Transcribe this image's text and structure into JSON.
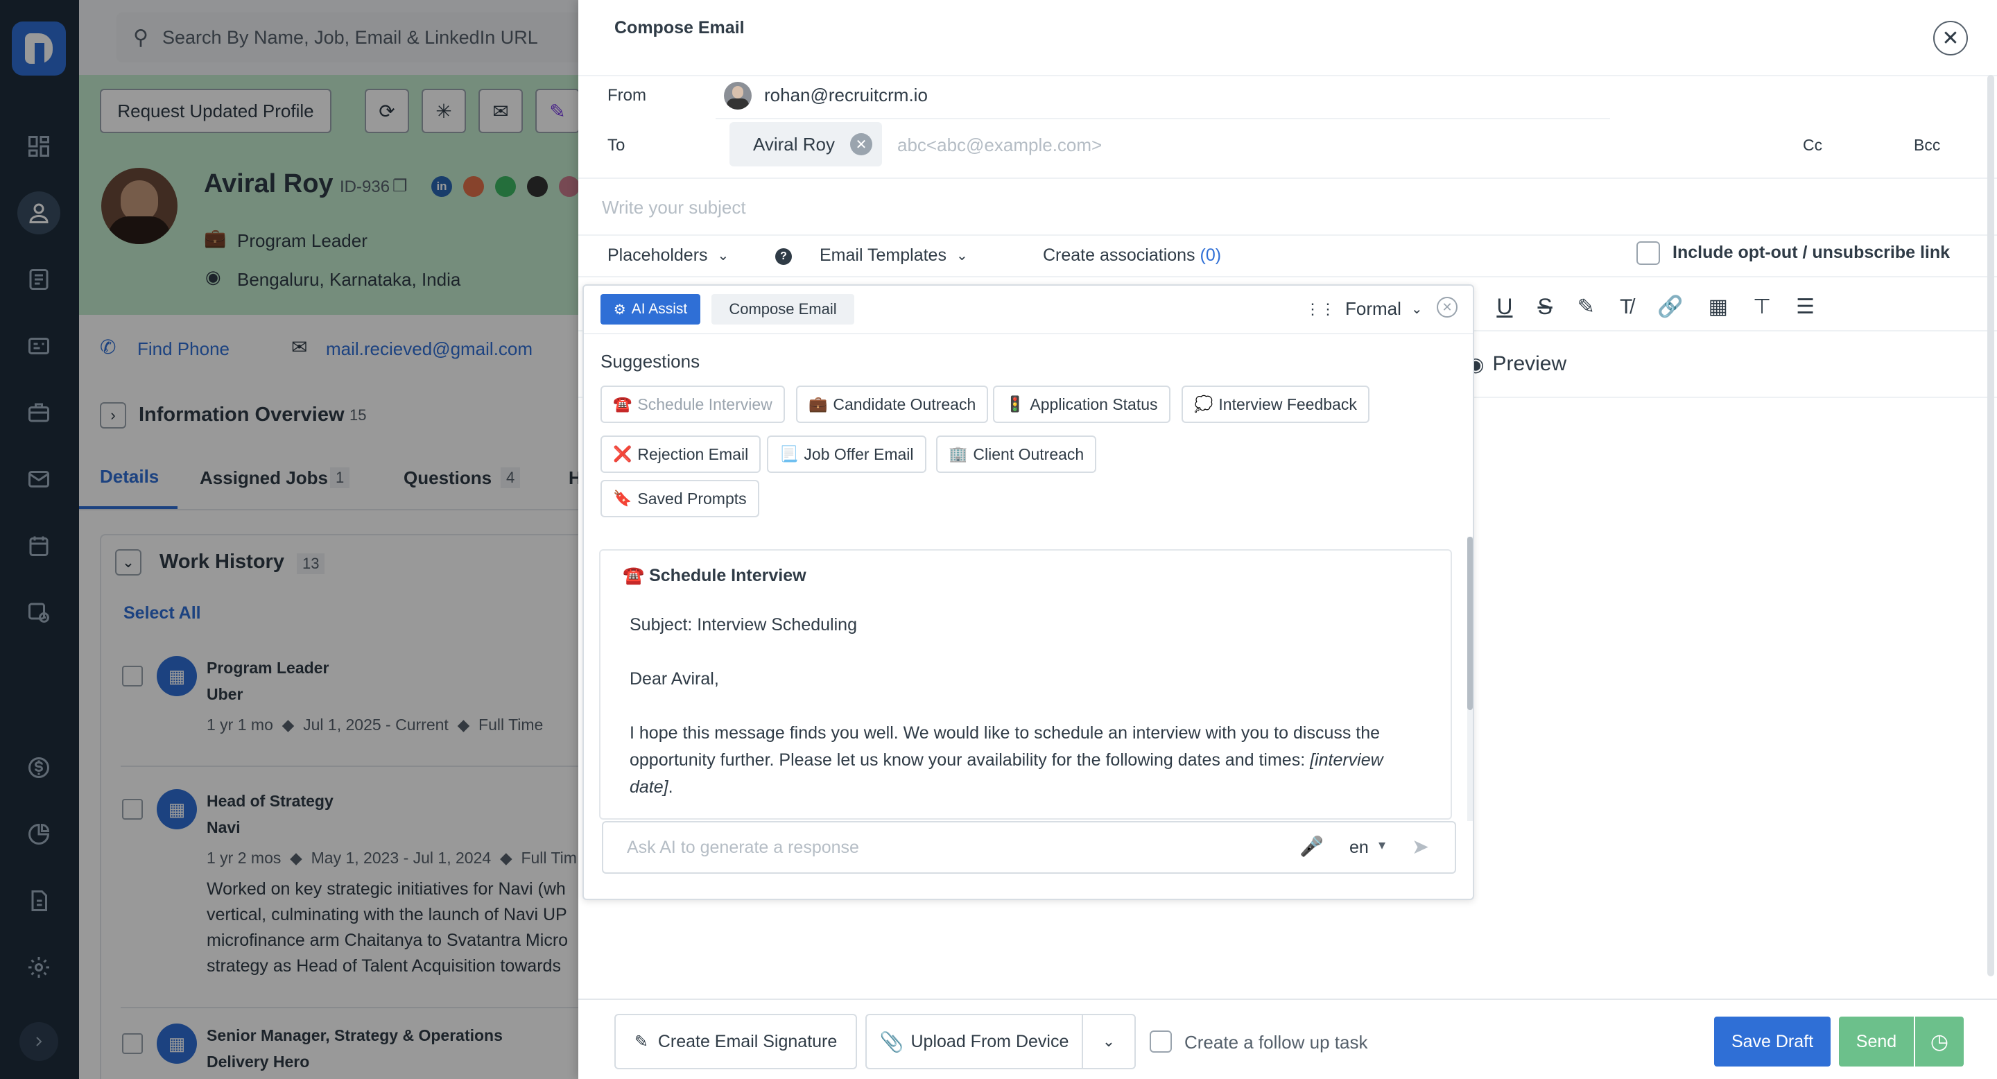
{
  "sidebar": {
    "items": [
      "home",
      "dashboard",
      "candidates",
      "contacts",
      "companies",
      "jobs",
      "email",
      "calendar",
      "tasks",
      "billing",
      "reports",
      "files",
      "settings",
      "expand"
    ]
  },
  "background": {
    "search_placeholder": "Search By Name, Job, Email & LinkedIn URL",
    "request_profile_label": "Request Updated Profile",
    "candidate_name": "Aviral Roy",
    "candidate_id": "ID-936",
    "job_title": "Program Leader",
    "location": "Bengaluru, Karnataka, India",
    "find_phone": "Find Phone",
    "email": "mail.recieved@gmail.com",
    "info_overview": "Information Overview",
    "info_overview_count": "15",
    "tabs": [
      {
        "label": "Details"
      },
      {
        "label": "Assigned Jobs",
        "count": "1"
      },
      {
        "label": "Questions",
        "count": "4"
      },
      {
        "label": "H"
      }
    ],
    "work_history_title": "Work History",
    "work_history_count": "13",
    "select_all": "Select All",
    "jobs": [
      {
        "title": "Program Leader",
        "company": "Uber",
        "duration": "1 yr 1 mo",
        "dates": "Jul 1, 2025 - Current",
        "type": "Full Time"
      },
      {
        "title": "Head of Strategy",
        "company": "Navi",
        "duration": "1 yr 2 mos",
        "dates": "May 1, 2023 - Jul 1, 2024",
        "type": "Full Tim",
        "description": [
          "Worked on key strategic initiatives for Navi (wh",
          "vertical, culminating with the launch of Navi UP",
          "microfinance arm Chaitanya to Svatantra Micro",
          "strategy as Head of Talent Acquisition towards"
        ]
      },
      {
        "title": "Senior Manager, Strategy & Operations",
        "company": "Delivery Hero"
      }
    ]
  },
  "modal": {
    "title": "Compose Email",
    "from_label": "From",
    "from_value": "rohan@recruitcrm.io",
    "to_label": "To",
    "to_chip": "Aviral Roy",
    "to_placeholder": "abc<abc@example.com>",
    "cc": "Cc",
    "bcc": "Bcc",
    "subject_placeholder": "Write your subject",
    "placeholders": "Placeholders",
    "email_templates": "Email Templates",
    "create_associations": "Create associations",
    "associations_count": "(0)",
    "optout": "Include opt-out / unsubscribe link",
    "preview": "Preview",
    "footer": {
      "signature": "Create Email Signature",
      "upload": "Upload From Device",
      "followup": "Create a follow up task",
      "save_draft": "Save Draft",
      "send": "Send"
    }
  },
  "ai": {
    "tab_active": "AI Assist",
    "tab_compose": "Compose Email",
    "tone": "Formal",
    "suggestions_title": "Suggestions",
    "suggestions": [
      {
        "emoji": "☎️",
        "label": "Schedule Interview"
      },
      {
        "emoji": "💼",
        "label": "Candidate Outreach"
      },
      {
        "emoji": "🚦",
        "label": "Application Status"
      },
      {
        "emoji": "💭",
        "label": "Interview Feedback"
      },
      {
        "emoji": "❌",
        "label": "Rejection Email"
      },
      {
        "emoji": "📃",
        "label": "Job Offer Email"
      },
      {
        "emoji": "🏢",
        "label": "Client Outreach"
      },
      {
        "emoji": "🔖",
        "label": "Saved Prompts"
      }
    ],
    "response": {
      "title_emoji": "☎️",
      "title": "Schedule Interview",
      "subject": "Subject: Interview Scheduling",
      "greeting": "Dear Aviral,",
      "body_l1": "I hope this message finds you well. We would like to schedule an interview with you to discuss the",
      "body_l2": "opportunity further. Please let us know your availability for the following dates and times: ",
      "body_l2_italic": "[interview",
      "body_l3_italic": "date]",
      "body_l3_end": "."
    },
    "input_placeholder": "Ask AI to generate a response",
    "language": "en"
  },
  "colors": {
    "sidebar": "#1f2e3d",
    "primary": "#2f6fd6",
    "send": "#6cc08b",
    "ai_tab": "#2f6fd6",
    "header_green": "#c4eccf"
  }
}
